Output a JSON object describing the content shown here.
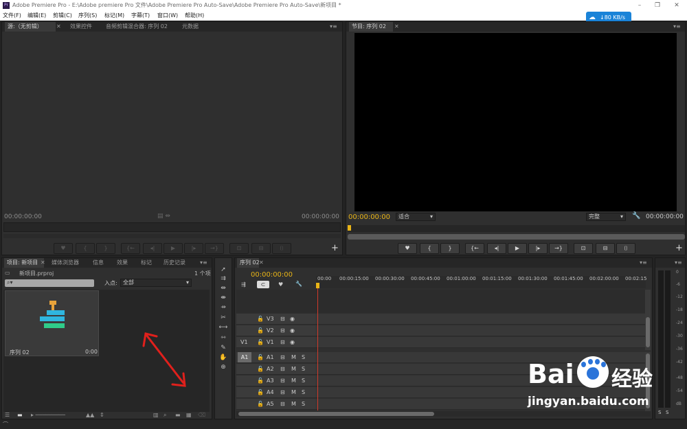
{
  "window": {
    "title": "Adobe Premiere Pro - E:\\Adobe premiere Pro 文件\\Adobe Premiere Pro Auto-Save\\Adobe Premiere Pro Auto-Save\\新项目 *",
    "logo": "Pr",
    "controls": {
      "minimize": "–",
      "restore": "❐",
      "close": "✕"
    }
  },
  "menu": [
    "文件(F)",
    "编辑(E)",
    "剪辑(C)",
    "序列(S)",
    "标记(M)",
    "字幕(T)",
    "窗口(W)",
    "帮助(H)"
  ],
  "net_speed": {
    "label": "↓80 KB/s",
    "icon": "cloud-icon",
    "color": "#1a83d8"
  },
  "source_panel": {
    "tabs": [
      "源:（无剪辑）",
      "效果控件",
      "音频剪辑混合器: 序列 02",
      "元数据"
    ],
    "timecode_left": "00:00:00:00",
    "timecode_right": "00:00:00:00"
  },
  "program_panel": {
    "tab": "节目: 序列 02",
    "timecode_left": "00:00:00:00",
    "zoom": "适合",
    "quality": "完整",
    "timecode_right": "00:00:00:00"
  },
  "project_panel": {
    "tabs": [
      "项目: 新项目",
      "媒体浏览器",
      "信息",
      "效果",
      "标记",
      "历史记录"
    ],
    "file": "新项目.prproj",
    "count": "1 个项",
    "in_label": "入点:",
    "in_value": "全部",
    "item_name": "序列 02",
    "item_duration": "0:00"
  },
  "timeline": {
    "tab": "序列 02",
    "timecode": "00:00:00:00",
    "ruler": [
      "00:00",
      "00:00:15:00",
      "00:00:30:00",
      "00:00:45:00",
      "00:01:00:00",
      "00:01:15:00",
      "00:01:30:00",
      "00:01:45:00",
      "00:02:00:00",
      "00:02:15"
    ],
    "video_tracks": [
      "V3",
      "V2",
      "V1"
    ],
    "audio_tracks": [
      "A1",
      "A2",
      "A3",
      "A4",
      "A5"
    ],
    "source_v": "V1",
    "source_a": "A1",
    "mute": "M",
    "solo": "S"
  },
  "meter": {
    "scale": [
      "0",
      "-6",
      "-12",
      "-18",
      "-24",
      "-30",
      "-36",
      "-42",
      "-48",
      "-54",
      "dB"
    ],
    "solo_labels": [
      "S",
      "S"
    ]
  },
  "watermark": {
    "brand": "Bai",
    "brand2": "经验",
    "url": "jingyan.baidu.com"
  }
}
